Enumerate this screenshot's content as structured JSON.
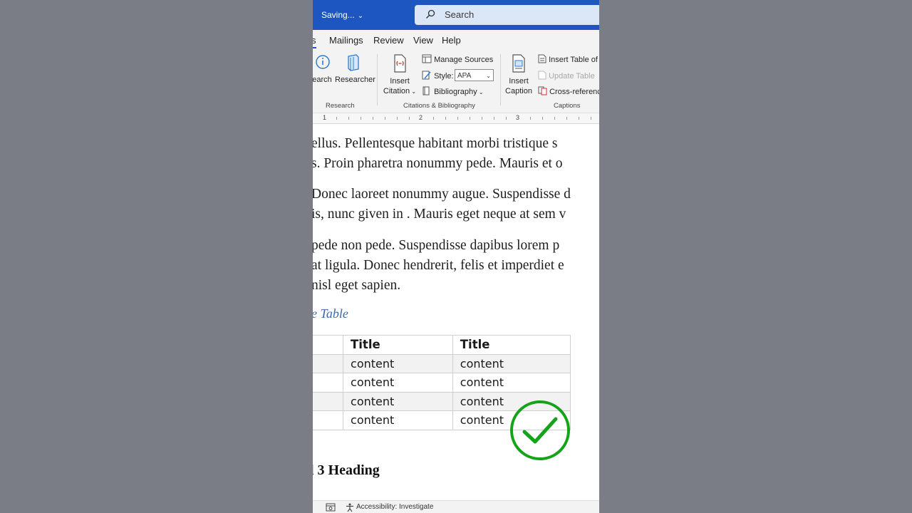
{
  "titlebar": {
    "saving": "Saving...",
    "search_label": "Search"
  },
  "tabs": {
    "fragment": "s",
    "items": [
      "Mailings",
      "Review",
      "View",
      "Help"
    ]
  },
  "ribbon": {
    "research": {
      "search_fragment": "earch",
      "researcher": "Researcher",
      "group_label": "Research"
    },
    "citations": {
      "insert_citation_line1": "Insert",
      "insert_citation_line2": "Citation",
      "manage_sources": "Manage Sources",
      "style_label": "Style:",
      "style_value": "APA",
      "bibliography": "Bibliography",
      "group_label": "Citations & Bibliography"
    },
    "captions": {
      "insert_caption_line1": "Insert",
      "insert_caption_line2": "Caption",
      "insert_table_of": "Insert Table of F",
      "update_table": "Update Table",
      "cross_reference": "Cross-reference",
      "group_label": "Captions"
    }
  },
  "ruler": {
    "marks": [
      "1",
      "2",
      "3"
    ]
  },
  "document": {
    "paragraphs": [
      [
        "ellus. Pellentesque habitant morbi tristique s",
        "s. Proin pharetra nonummy pede. Mauris et o"
      ],
      [
        "Donec laoreet nonummy augue. Suspendisse d",
        "is, nunc given in . Mauris eget neque at sem v"
      ],
      [
        "pede non pede. Suspendisse dapibus lorem p",
        "at ligula. Donec hendrerit, felis et imperdiet e",
        "nisl eget sapien."
      ]
    ],
    "caption": "e Table",
    "table": {
      "headers": [
        "",
        "Title",
        "Title"
      ],
      "rows": [
        [
          "",
          "content",
          "content"
        ],
        [
          "",
          "content",
          "content"
        ],
        [
          "",
          "content",
          "content"
        ],
        [
          "",
          "content",
          "content"
        ]
      ]
    },
    "heading3": "l 3 Heading"
  },
  "statusbar": {
    "accessibility": "Accessibility: Investigate"
  },
  "colors": {
    "titlebar": "#1d56c0",
    "check": "#15a31a",
    "caption": "#3b6aa8"
  }
}
